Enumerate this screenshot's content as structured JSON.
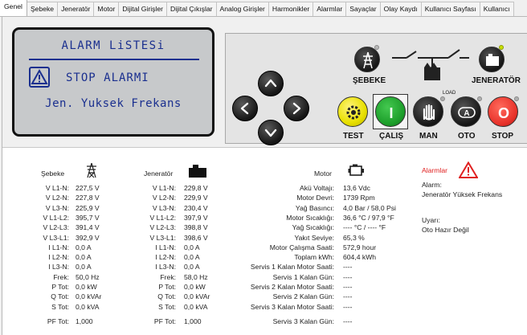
{
  "tabs": [
    "Genel",
    "Şebeke",
    "Jeneratör",
    "Motor",
    "Dijital Girişler",
    "Dijital Çıkışlar",
    "Analog Girişler",
    "Harmonikler",
    "Alarmlar",
    "Sayaçlar",
    "Olay Kaydı",
    "Kullanıcı Sayfası",
    "Kullanıcı"
  ],
  "lcd": {
    "title": "ALARM LiSTESi",
    "status": "STOP ALARMI",
    "reason": "Jen. Yuksek Frekans"
  },
  "panel": {
    "mains_label": "ŞEBEKE",
    "gen_label": "JENERATÖR",
    "load_label": "LOAD",
    "test_label": "TEST",
    "run_label": "ÇALIŞ",
    "man_label": "MAN",
    "auto_label": "OTO",
    "stop_label": "STOP",
    "auto_icon_text": "A",
    "stop_icon_text": "O",
    "run_icon_text": "I"
  },
  "colors": {
    "lcd_bg": "#c7c9cb",
    "lcd_text": "#1a2f8f",
    "alarm_red": "#e02020",
    "test_yellow": "#e8e000",
    "run_green": "#1c9e2a",
    "stop_red": "#e8322a"
  },
  "sebeke": {
    "title": "Şebeke",
    "rows": [
      [
        "V L1-N:",
        "227,5 V"
      ],
      [
        "V L2-N:",
        "227,8 V"
      ],
      [
        "V L3-N:",
        "225,9 V"
      ],
      [
        "V L1-L2:",
        "395,7 V"
      ],
      [
        "V L2-L3:",
        "391,4 V"
      ],
      [
        "V L3-L1:",
        "392,9 V"
      ],
      [
        "I L1-N:",
        "0,0 A"
      ],
      [
        "I L2-N:",
        "0,0 A"
      ],
      [
        "I L3-N:",
        "0,0 A"
      ],
      [
        "Frek:",
        "50,0 Hz"
      ],
      [
        "P Tot:",
        "0,0 kW"
      ],
      [
        "Q Tot:",
        "0,0 kVAr"
      ],
      [
        "S Tot:",
        "0,0 kVA"
      ],
      [
        "PF Tot:",
        "1,000"
      ]
    ]
  },
  "jenerator": {
    "title": "Jeneratör",
    "rows": [
      [
        "V L1-N:",
        "229,8 V"
      ],
      [
        "V L2-N:",
        "229,9 V"
      ],
      [
        "V L3-N:",
        "230,4 V"
      ],
      [
        "V L1-L2:",
        "397,9 V"
      ],
      [
        "V L2-L3:",
        "398,8 V"
      ],
      [
        "V L3-L1:",
        "398,6 V"
      ],
      [
        "I L1-N:",
        "0,0 A"
      ],
      [
        "I L2-N:",
        "0,0 A"
      ],
      [
        "I L3-N:",
        "0,0 A"
      ],
      [
        "Frek:",
        "58,0 Hz"
      ],
      [
        "P Tot:",
        "0,0 kW"
      ],
      [
        "Q Tot:",
        "0,0 kVAr"
      ],
      [
        "S Tot:",
        "0,0 kVA"
      ],
      [
        "PF Tot:",
        "1,000"
      ]
    ]
  },
  "motor": {
    "title": "Motor",
    "rows": [
      [
        "Akü Voltajı:",
        "13,6 Vdc"
      ],
      [
        "Motor Devri:",
        "1739 Rpm"
      ],
      [
        "Yağ Basıncı:",
        "4,0 Bar / 58,0 Psi"
      ],
      [
        "Motor Sıcaklığı:",
        "36,6 °C / 97,9 °F"
      ],
      [
        "Yağ Sıcaklığı:",
        "---- °C / ---- °F"
      ],
      [
        "Yakıt Seviye:",
        "65,3 %"
      ],
      [
        "Motor Çalışma Saati:",
        "572,9 hour"
      ],
      [
        "Toplam kWh:",
        "604,4 kWh"
      ],
      [
        "Servis 1 Kalan Motor Saati:",
        "----"
      ],
      [
        "Servis 1 Kalan Gün:",
        "----"
      ],
      [
        "Servis 2 Kalan Motor Saati:",
        "----"
      ],
      [
        "Servis 2 Kalan Gün:",
        "----"
      ],
      [
        "Servis 3 Kalan Motor Saati:",
        "----"
      ],
      [
        "Servis 3 Kalan Gün:",
        "----"
      ]
    ]
  },
  "alarms": {
    "title": "Alarmlar",
    "alarm_label": "Alarm:",
    "alarm_value": "Jeneratör Yüksek Frekans",
    "warning_label": "Uyarı:",
    "warning_value": "Oto Hazır Değil"
  }
}
